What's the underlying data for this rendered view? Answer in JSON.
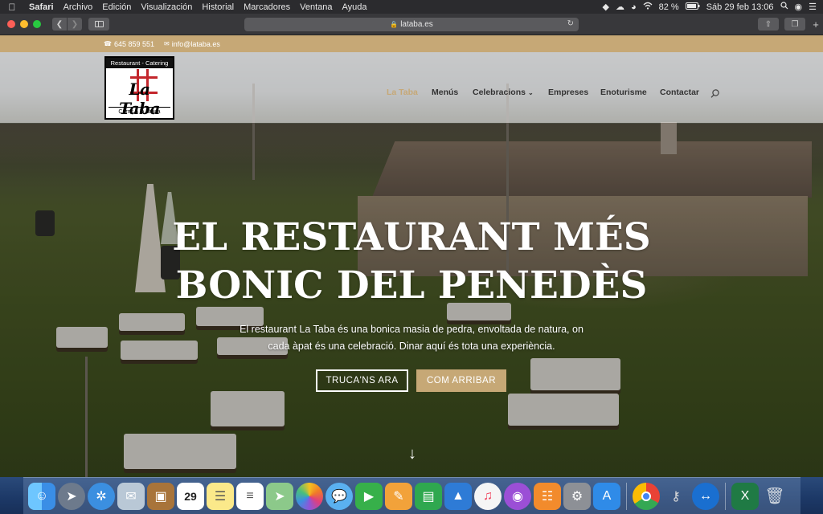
{
  "menubar": {
    "app": "Safari",
    "items": [
      "Archivo",
      "Edición",
      "Visualización",
      "Historial",
      "Marcadores",
      "Ventana",
      "Ayuda"
    ],
    "battery": "82 %",
    "datetime": "Sáb 29 feb  13:06"
  },
  "browser": {
    "url": "lataba.es"
  },
  "topbar": {
    "phone": "645 859 551",
    "email": "info@lataba.es"
  },
  "logo": {
    "top": "Restaurant - Catering",
    "name": "La Taba",
    "bottom": "Carns a la Brasa"
  },
  "nav": {
    "items": [
      {
        "label": "La Taba",
        "active": true
      },
      {
        "label": "Menús"
      },
      {
        "label": "Celebracions",
        "dropdown": true
      },
      {
        "label": "Empreses"
      },
      {
        "label": "Enoturisme"
      },
      {
        "label": "Contactar"
      }
    ]
  },
  "hero": {
    "title_line1": "EL RESTAURANT MÉS",
    "title_line2": "BONIC DEL PENEDÈS",
    "subtitle_line1": "El restaurant La Taba és una bonica masia de pedra, envoltada de natura, on",
    "subtitle_line2": "cada àpat és una celebració. Dinar aquí és tota una experiència.",
    "cta_call": "TRUCA'NS ARA",
    "cta_arrive": "COM ARRIBAR",
    "scroll_arrow": "↓"
  },
  "colors": {
    "accent": "#c6a876",
    "menubar": "#2b2b2e",
    "toolbar": "#38383b"
  },
  "dock": {
    "icons": [
      "finder-icon",
      "launchpad-icon",
      "safari-icon",
      "mail-icon",
      "notes-book-icon",
      "calendar-icon",
      "notes-icon",
      "reminders-icon",
      "maps-icon",
      "photos-icon",
      "messages-icon",
      "facetime-icon",
      "pages-icon",
      "numbers-icon",
      "keynote-icon",
      "music-icon",
      "podcasts-icon",
      "books-icon",
      "system-preferences-icon",
      "app-store-icon",
      "chrome-icon",
      "keychain-icon",
      "teamviewer-icon",
      "excel-icon",
      "trash-icon"
    ],
    "calendar_day": "29"
  }
}
